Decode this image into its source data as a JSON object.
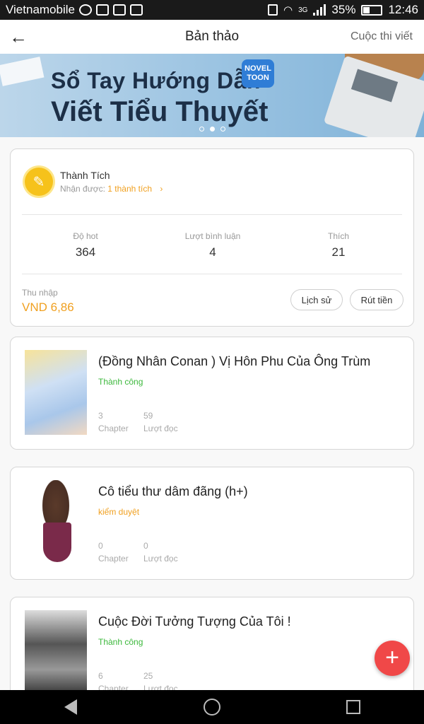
{
  "status_bar": {
    "carrier": "Vietnamobile",
    "network": "3G",
    "battery": "35%",
    "time": "12:46"
  },
  "app_bar": {
    "title": "Bản thảo",
    "contest_link": "Cuộc thi viết",
    "back_icon": "arrow-left-icon"
  },
  "banner": {
    "line1": "Sổ Tay Hướng Dẫn",
    "line2": "Viết Tiểu Thuyết",
    "logo_line1": "NOVEL",
    "logo_line2": "TOON",
    "active_dot": 2,
    "dot_count": 3
  },
  "achievement": {
    "title": "Thành Tích",
    "received_label": "Nhận được:",
    "received_value": "1 thành tích",
    "chevron": "›"
  },
  "metrics": [
    {
      "label": "Độ hot",
      "value": "364"
    },
    {
      "label": "Lượt bình luận",
      "value": "4"
    },
    {
      "label": "Thích",
      "value": "21"
    }
  ],
  "income": {
    "label": "Thu nhập",
    "value": "VND 6,86",
    "history_button": "Lịch sử",
    "withdraw_button": "Rút tiền"
  },
  "books": [
    {
      "title": "(Đồng Nhân Conan ) Vị Hôn Phu Của Ông Trùm",
      "status": "Thành công",
      "status_color": "#3cb83c",
      "chapters": "3",
      "chapters_label": "Chapter",
      "reads": "59",
      "reads_label": "Lượt đọc"
    },
    {
      "title": "Cô tiểu thư dâm đãng (h+)",
      "status": "kiểm duyệt",
      "status_color": "#f0a020",
      "chapters": "0",
      "chapters_label": "Chapter",
      "reads": "0",
      "reads_label": "Lượt đọc"
    },
    {
      "title": "Cuộc Đời Tưởng Tượng Của Tôi !",
      "status": "Thành công",
      "status_color": "#3cb83c",
      "chapters": "6",
      "chapters_label": "Chapter",
      "reads": "25",
      "reads_label": "Lượt đọc"
    }
  ],
  "fab": {
    "label": "+",
    "icon": "plus-icon",
    "color": "#f04848"
  },
  "colors": {
    "accent_orange": "#f0a020",
    "success_green": "#3cb83c"
  }
}
